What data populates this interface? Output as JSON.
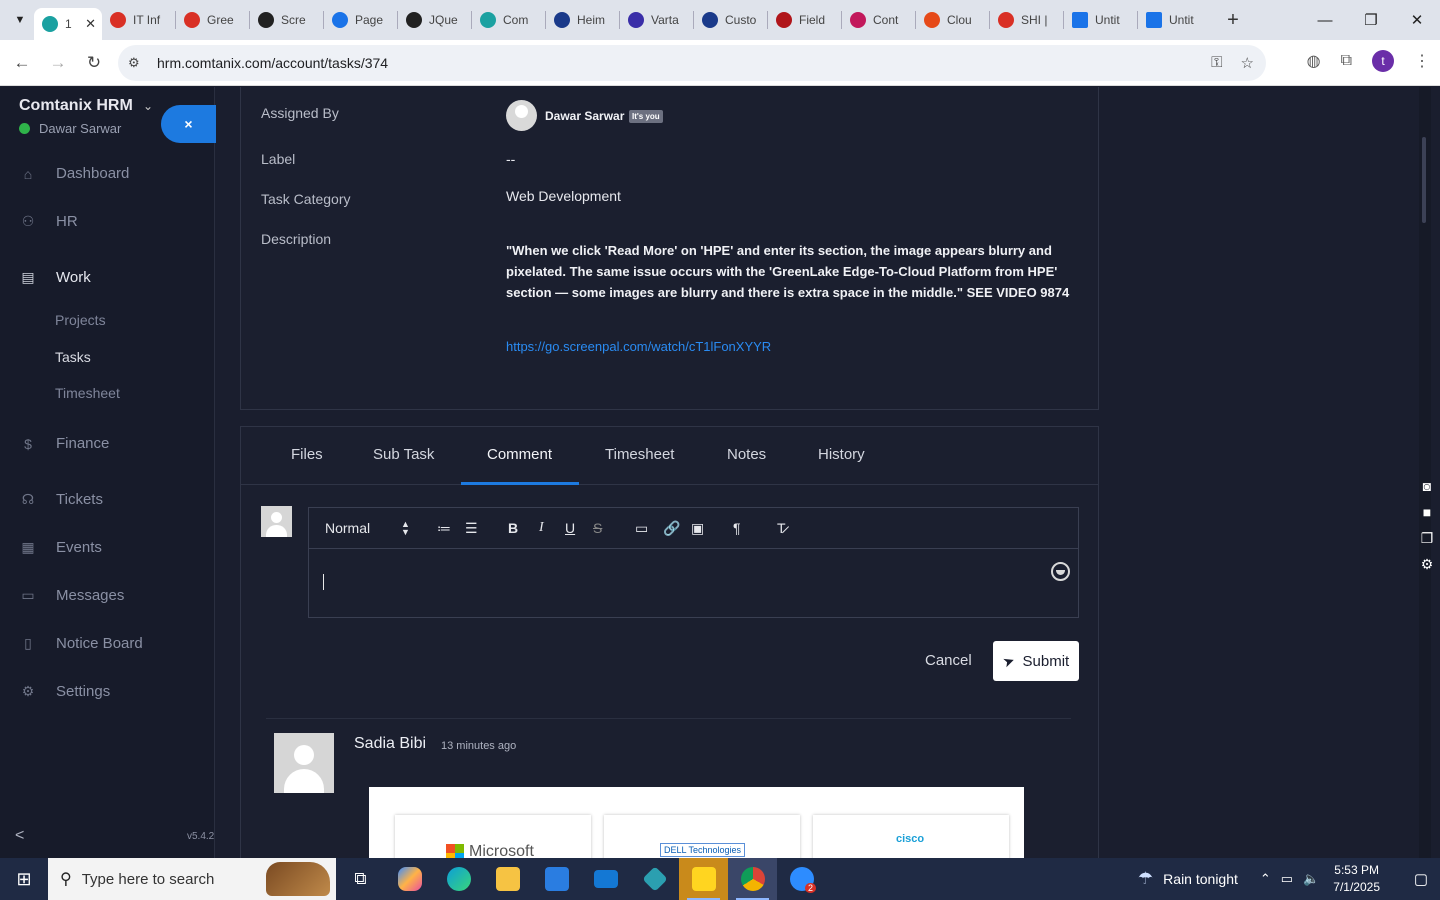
{
  "browser": {
    "tabs": [
      {
        "label": "1",
        "color": "#1a73e8",
        "active": true
      },
      {
        "label": "IT Inf",
        "color": "#d93025"
      },
      {
        "label": "Gree",
        "color": "#d93025"
      },
      {
        "label": "Scre",
        "color": "#222222"
      },
      {
        "label": "Page",
        "color": "#1a73e8"
      },
      {
        "label": "JQue",
        "color": "#222222"
      },
      {
        "label": "Com",
        "color": "#1ba1a1"
      },
      {
        "label": "Heim",
        "color": "#1a3a8a"
      },
      {
        "label": "Varta",
        "color": "#3a2ea8"
      },
      {
        "label": "Custo",
        "color": "#1a3a8a"
      },
      {
        "label": "Field",
        "color": "#b0151a"
      },
      {
        "label": "Cont",
        "color": "#c2185b"
      },
      {
        "label": "Clou",
        "color": "#e64a19"
      },
      {
        "label": "SHI |",
        "color": "#d93025"
      },
      {
        "label": "Untit",
        "color": "#1a73e8"
      },
      {
        "label": "Untit",
        "color": "#1a73e8"
      }
    ],
    "url": "hrm.comtanix.com/account/tasks/374",
    "profile_initial": "t"
  },
  "sidebar": {
    "brand": "Comtanix HRM",
    "user": "Dawar Sarwar",
    "close_label": "×",
    "items": [
      {
        "label": "Dashboard",
        "icon": "home-icon"
      },
      {
        "label": "HR",
        "icon": "people-icon"
      },
      {
        "label": "Work",
        "icon": "briefcase-icon"
      },
      {
        "label": "Finance",
        "icon": "dollar-icon"
      },
      {
        "label": "Tickets",
        "icon": "headset-icon"
      },
      {
        "label": "Events",
        "icon": "calendar-icon"
      },
      {
        "label": "Messages",
        "icon": "chat-icon"
      },
      {
        "label": "Notice Board",
        "icon": "clipboard-icon"
      },
      {
        "label": "Settings",
        "icon": "gear-icon"
      }
    ],
    "work_sub": [
      "Projects",
      "Tasks",
      "Timesheet"
    ],
    "version": "v5.4.2"
  },
  "task": {
    "assigned_by_label": "Assigned By",
    "assigned_by": "Dawar Sarwar",
    "its_you": "It's you",
    "label_label": "Label",
    "label_value": "--",
    "category_label": "Task Category",
    "category_value": "Web Development",
    "description_label": "Description",
    "description": "\"When we click 'Read More' on 'HPE' and enter its section, the image appears blurry and pixelated. The same issue occurs with the 'GreenLake Edge-To-Cloud Platform from HPE' section — some images are blurry and there is extra space in the middle.\" SEE VIDEO 9874",
    "link": "https://go.screenpal.com/watch/cT1lFonXYYR"
  },
  "tabs": [
    "Files",
    "Sub Task",
    "Comment",
    "Timesheet",
    "Notes",
    "History"
  ],
  "active_tab": "Comment",
  "editor": {
    "format_select": "Normal",
    "cancel": "Cancel",
    "submit": "Submit"
  },
  "comment": {
    "author": "Sadia Bibi",
    "time": "13 minutes ago",
    "logos": [
      "Microsoft",
      "DELL Technologies",
      "cisco"
    ]
  },
  "taskbar": {
    "search_placeholder": "Type here to search",
    "weather": "Rain tonight",
    "time": "5:53 PM",
    "date": "7/1/2025",
    "zoom_badge": "2"
  }
}
